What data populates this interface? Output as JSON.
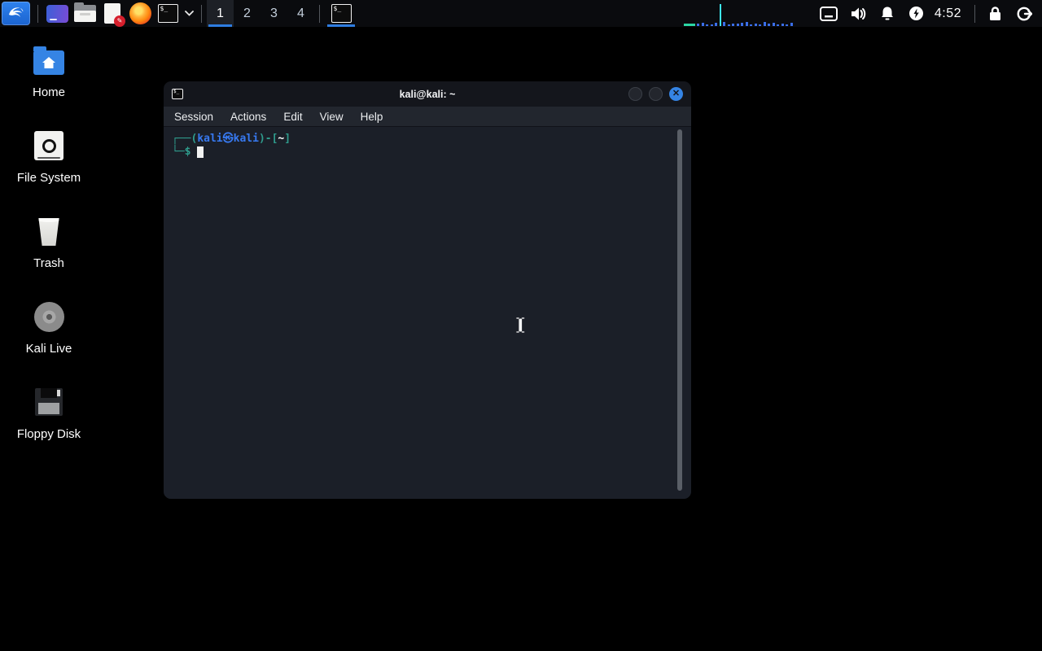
{
  "panel": {
    "workspaces": [
      "1",
      "2",
      "3",
      "4"
    ],
    "active_workspace": "1",
    "clock": "4:52",
    "network_graph": {
      "default_color": "#3a6ee8",
      "bars": [
        {
          "w": 14,
          "h": 3,
          "c": "#2bd6a3"
        },
        {
          "h": 3
        },
        {
          "h": 4
        },
        {
          "h": 2
        },
        {
          "h": 2
        },
        {
          "h": 4
        },
        {
          "w": 2,
          "h": 27,
          "c": "#3ee6f0"
        },
        {
          "h": 5
        },
        {
          "h": 2
        },
        {
          "h": 3
        },
        {
          "h": 3
        },
        {
          "h": 4
        },
        {
          "h": 5
        },
        {
          "h": 2
        },
        {
          "h": 3
        },
        {
          "h": 2
        },
        {
          "h": 5
        },
        {
          "h": 3
        },
        {
          "h": 4
        },
        {
          "h": 2
        },
        {
          "h": 3
        },
        {
          "h": 2
        },
        {
          "h": 4
        }
      ]
    }
  },
  "desktop": {
    "icon_labels": [
      "Home",
      "File System",
      "Trash",
      "Kali Live",
      "Floppy Disk"
    ]
  },
  "terminal": {
    "title": "kali@kali: ~",
    "menu_items": [
      "Session",
      "Actions",
      "Edit",
      "View",
      "Help"
    ],
    "prompt": {
      "frame_top": "┌──(",
      "user": "kali㉿kali",
      "frame_mid": ")-[",
      "cwd": "~",
      "frame_end": "]",
      "frame_bottom": "└─$"
    },
    "close_glyph": "✕",
    "doc_badge_glyph": "✎",
    "term_glyph": "$_",
    "colors": {
      "accent_blue": "#2e7de1",
      "close_button": "#3584e4",
      "prompt_frame": "#2f9c8d",
      "prompt_user": "#3779f0"
    }
  }
}
